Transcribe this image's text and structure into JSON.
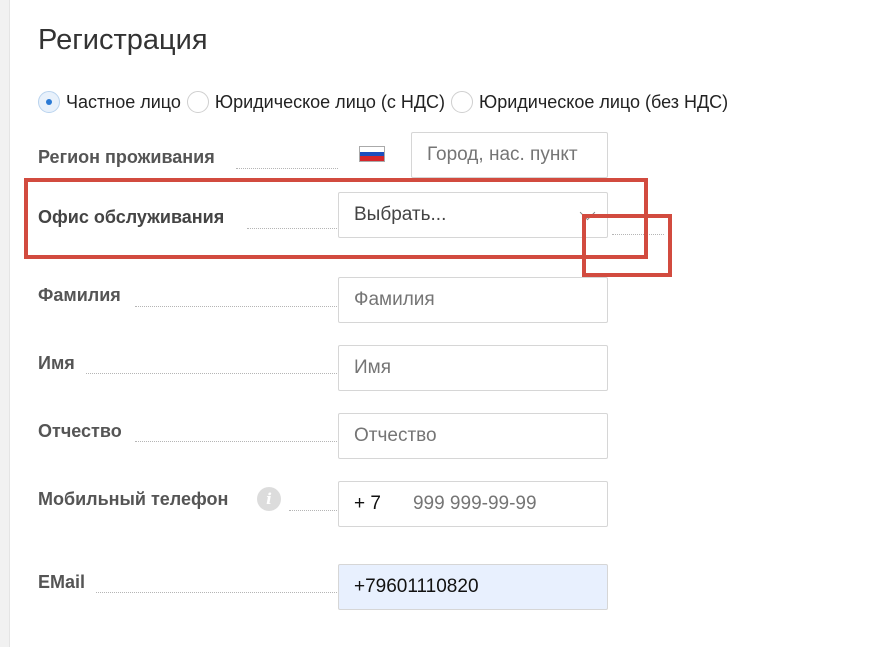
{
  "form": {
    "title": "Регистрация",
    "radio_options": [
      {
        "label": "Частное лицо",
        "checked": true
      },
      {
        "label": "Юридическое лицо (с НДС)",
        "checked": false
      },
      {
        "label": "Юридическое лицо (без НДС)",
        "checked": false
      }
    ],
    "region": {
      "label": "Регион проживания",
      "placeholder": "Город, нас. пункт",
      "flag_colors": [
        "#ffffff",
        "#1c4fbf",
        "#d6262b"
      ]
    },
    "office": {
      "label": "Офис обслуживания",
      "value": "Выбрать..."
    },
    "lastname": {
      "label": "Фамилия",
      "placeholder": "Фамилия"
    },
    "firstname": {
      "label": "Имя",
      "placeholder": "Имя"
    },
    "patronymic": {
      "label": "Отчество",
      "placeholder": "Отчество"
    },
    "phone": {
      "label": "Мобильный телефон",
      "prefix": "+ 7",
      "placeholder": "999 999-99-99",
      "info_icon": "info-icon"
    },
    "email": {
      "label": "EMail",
      "value": "+79601110820"
    }
  },
  "annotation_color": "#d24b3f"
}
